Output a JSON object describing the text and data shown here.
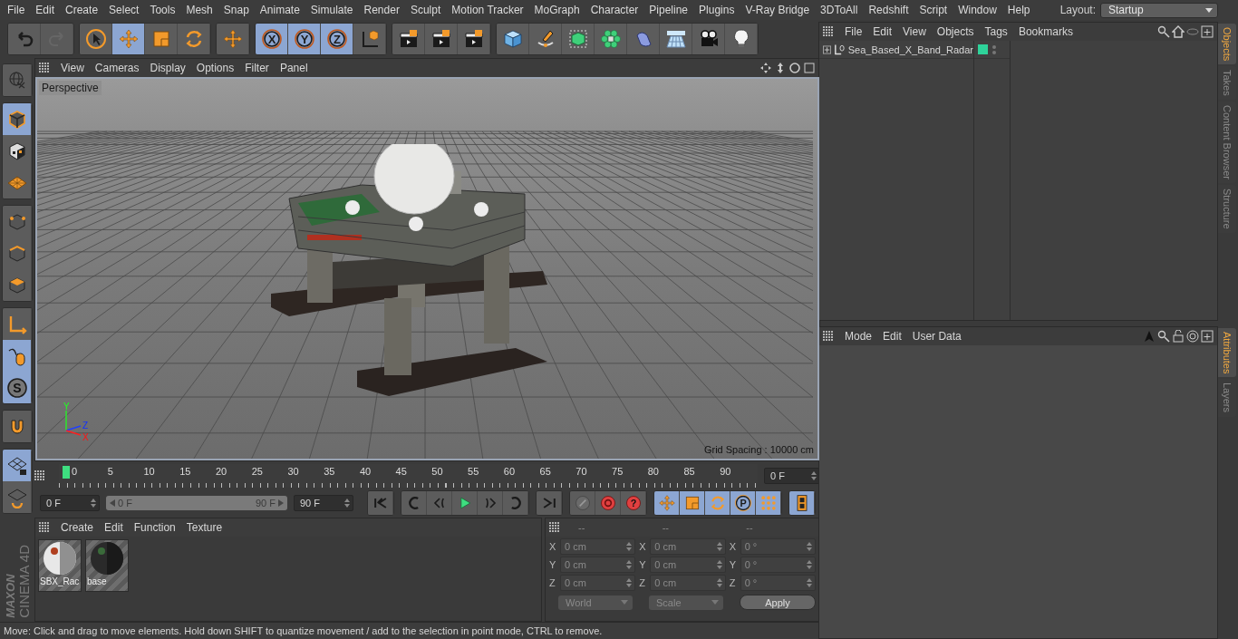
{
  "menu_bar": [
    "File",
    "Edit",
    "Create",
    "Select",
    "Tools",
    "Mesh",
    "Snap",
    "Animate",
    "Simulate",
    "Render",
    "Sculpt",
    "Motion Tracker",
    "MoGraph",
    "Character",
    "Pipeline",
    "Plugins",
    "V-Ray Bridge",
    "3DToAll",
    "Redshift",
    "Script",
    "Window",
    "Help"
  ],
  "layout": {
    "label": "Layout:",
    "value": "Startup"
  },
  "toolbar": [
    [
      {
        "kind": "undo",
        "selected": false,
        "disabled": false
      },
      {
        "kind": "redo",
        "selected": false,
        "disabled": true
      }
    ],
    [
      {
        "kind": "select",
        "selected": false,
        "disabled": false
      },
      {
        "kind": "move",
        "selected": true,
        "disabled": false
      },
      {
        "kind": "scale",
        "selected": false,
        "disabled": false
      },
      {
        "kind": "rotate",
        "selected": false,
        "disabled": false
      }
    ],
    [
      {
        "kind": "move",
        "selected": false,
        "disabled": false
      }
    ],
    [
      {
        "kind": "axis",
        "label": "X",
        "selected": true,
        "disabled": false
      },
      {
        "kind": "axis",
        "label": "Y",
        "selected": true,
        "disabled": false
      },
      {
        "kind": "axis",
        "label": "Z",
        "selected": true,
        "disabled": false
      },
      {
        "kind": "coord",
        "selected": false,
        "disabled": false
      }
    ],
    [
      {
        "kind": "clapper",
        "selected": false,
        "disabled": false
      },
      {
        "kind": "clapper",
        "selected": false,
        "disabled": false
      },
      {
        "kind": "clapper",
        "selected": false,
        "disabled": false
      }
    ],
    [
      {
        "kind": "cube",
        "selected": false,
        "disabled": false
      },
      {
        "kind": "pen",
        "selected": false,
        "disabled": false
      },
      {
        "kind": "greencube",
        "selected": false,
        "disabled": false
      },
      {
        "kind": "flower",
        "selected": false,
        "disabled": false
      },
      {
        "kind": "bend",
        "selected": false,
        "disabled": false
      },
      {
        "kind": "floor",
        "selected": false,
        "disabled": false
      },
      {
        "kind": "camera",
        "selected": false,
        "disabled": false
      },
      {
        "kind": "light",
        "selected": false,
        "disabled": false
      }
    ]
  ],
  "left_tools": [
    [
      {
        "kind": "globe",
        "selected": false
      }
    ],
    [
      {
        "kind": "model",
        "selected": true
      },
      {
        "kind": "checker",
        "selected": false
      },
      {
        "kind": "plane",
        "selected": false
      }
    ],
    [
      {
        "kind": "points",
        "selected": false
      },
      {
        "kind": "edges",
        "selected": false
      },
      {
        "kind": "polys",
        "selected": false
      }
    ],
    [
      {
        "kind": "axes",
        "selected": false
      },
      {
        "kind": "mouse",
        "selected": true
      },
      {
        "kind": "solo",
        "label": "S",
        "selected": true
      }
    ],
    [
      {
        "kind": "magnet",
        "selected": false
      }
    ],
    [
      {
        "kind": "gridlock",
        "selected": true
      },
      {
        "kind": "gridsync",
        "selected": false
      }
    ]
  ],
  "logo": {
    "brand": "MAXON",
    "product": "CINEMA 4D"
  },
  "viewport": {
    "menu": [
      "View",
      "Cameras",
      "Display",
      "Options",
      "Filter",
      "Panel"
    ],
    "camera": "Perspective",
    "grid_spacing": "Grid Spacing : 10000 cm",
    "axis_labels": [
      "Y",
      "Z",
      "X"
    ]
  },
  "timeline": {
    "ticks": [
      "0",
      "5",
      "10",
      "15",
      "20",
      "25",
      "30",
      "35",
      "40",
      "45",
      "50",
      "55",
      "60",
      "65",
      "70",
      "75",
      "80",
      "85",
      "90"
    ],
    "level": 0,
    "current_frame": "0 F"
  },
  "playback": {
    "start": "0 F",
    "range_start": "0 F",
    "range_end": "90 F",
    "end": "90 F",
    "range": {
      "level": 1
    },
    "buttons": [
      [
        {
          "kind": "first",
          "selected": false
        }
      ],
      [
        {
          "kind": "prevkey",
          "selected": false
        },
        {
          "kind": "prev",
          "selected": false
        },
        {
          "kind": "play",
          "selected": false
        },
        {
          "kind": "next",
          "selected": false
        },
        {
          "kind": "nextkey",
          "selected": false
        }
      ],
      [
        {
          "kind": "last",
          "selected": false
        }
      ],
      [
        {
          "kind": "autokey",
          "selected": false
        },
        {
          "kind": "record",
          "selected": false
        },
        {
          "kind": "help",
          "label": "?",
          "selected": false
        }
      ],
      [
        {
          "kind": "move",
          "selected": true
        },
        {
          "kind": "scale",
          "selected": true
        },
        {
          "kind": "rotate",
          "selected": true
        },
        {
          "kind": "param",
          "label": "P",
          "selected": true
        },
        {
          "kind": "dots",
          "selected": true
        }
      ],
      [
        {
          "kind": "film",
          "selected": true
        }
      ]
    ]
  },
  "materials": {
    "menu": [
      "Create",
      "Edit",
      "Function",
      "Texture"
    ],
    "items": [
      {
        "name": "SBX_Rac",
        "kind": "light"
      },
      {
        "name": "base",
        "kind": "dark"
      }
    ]
  },
  "coordinates": {
    "disabled": true,
    "columns": [
      {
        "header": "--",
        "fields": [
          {
            "axis": "X",
            "value": "0 cm"
          },
          {
            "axis": "Y",
            "value": "0 cm"
          },
          {
            "axis": "Z",
            "value": "0 cm"
          }
        ]
      },
      {
        "header": "--",
        "fields": [
          {
            "axis": "X",
            "value": "0 cm"
          },
          {
            "axis": "Y",
            "value": "0 cm"
          },
          {
            "axis": "Z",
            "value": "0 cm"
          }
        ]
      },
      {
        "header": "--",
        "fields": [
          {
            "axis": "X",
            "value": "0 °"
          },
          {
            "axis": "Y",
            "value": "0 °"
          },
          {
            "axis": "Z",
            "value": "0 °"
          }
        ]
      }
    ],
    "dropdowns": [
      "World",
      "Scale"
    ],
    "apply": "Apply"
  },
  "object_manager": {
    "menu": [
      "File",
      "Edit",
      "View",
      "Objects",
      "Tags",
      "Bookmarks"
    ],
    "objects": [
      {
        "name": "Sea_Based_X_Band_Radar",
        "expanded": false,
        "color": "#2ed39a"
      }
    ],
    "tabs": [
      {
        "label": "Objects",
        "selected": true
      },
      {
        "label": "Takes",
        "selected": false
      },
      {
        "label": "Content Browser",
        "selected": false
      },
      {
        "label": "Structure",
        "selected": false
      }
    ]
  },
  "attributes": {
    "menu": [
      "Mode",
      "Edit",
      "User Data"
    ],
    "tabs": [
      {
        "label": "Attributes",
        "selected": true
      },
      {
        "label": "Layers",
        "selected": false
      }
    ]
  },
  "status_bar": "Move: Click and drag to move elements. Hold down SHIFT to quantize movement / add to the selection in point mode, CTRL to remove."
}
